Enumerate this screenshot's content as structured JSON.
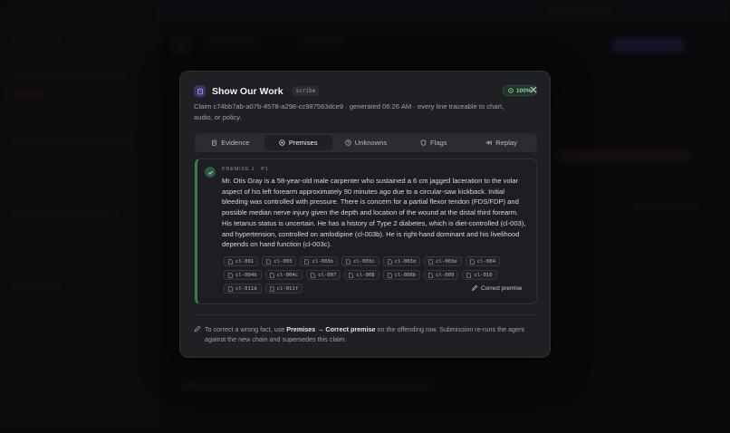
{
  "modal": {
    "title": "Show Our Work",
    "badge": "scribe",
    "percent": "100%",
    "subtitle": "Claim c74bb7ab-a07b-4578-a298-cc987563dce9 · generated 06:26 AM · every line traceable to chart, audio, or policy."
  },
  "tabs": [
    {
      "label": "Evidence",
      "icon": "clipboard-icon"
    },
    {
      "label": "Premises",
      "icon": "target-icon"
    },
    {
      "label": "Unknowns",
      "icon": "question-icon"
    },
    {
      "label": "Flags",
      "icon": "shield-icon"
    },
    {
      "label": "Replay",
      "icon": "rewind-icon"
    }
  ],
  "active_tab": "Premises",
  "premise": {
    "label": "PREMISE 1 · P1",
    "text": "Mr. Otis Gray is a 58-year-old male carpenter who sustained a 6 cm jagged laceration to the volar aspect of his left forearm approximately 90 minutes ago due to a circular-saw kickback. Initial bleeding was controlled with pressure. There is concern for a partial flexor tendon (FDS/FDP) and possible median nerve injury given the depth and location of the wound at the distal third forearm. His tetanus status is uncertain. He has a history of Type 2 diabetes, which is diet-controlled (cl-003), and hypertension, controlled on amlodipine (cl-003b). He is right-hand dominant and his livelihood depends on hand function (cl-003c).",
    "chips": [
      "cl-001",
      "cl-003",
      "cl-003b",
      "cl-003c",
      "cl-003d",
      "cl-003e",
      "cl-004",
      "cl-004b",
      "cl-004c",
      "cl-007",
      "cl-008",
      "cl-008b",
      "cl-009",
      "cl-010",
      "cl-011d",
      "cl-011f"
    ],
    "correct_label": "Correct premise"
  },
  "footer": {
    "pre": "To correct a wrong fact, use ",
    "bold": "Premises → Correct premise",
    "post": " on the offending row. Submission re-runs the agent against the new chain and supersedes this claim."
  },
  "colors": {
    "accent_purple": "#3a3466",
    "success_green": "#3b7a52",
    "badge_green_text": "#8fd3a1"
  }
}
